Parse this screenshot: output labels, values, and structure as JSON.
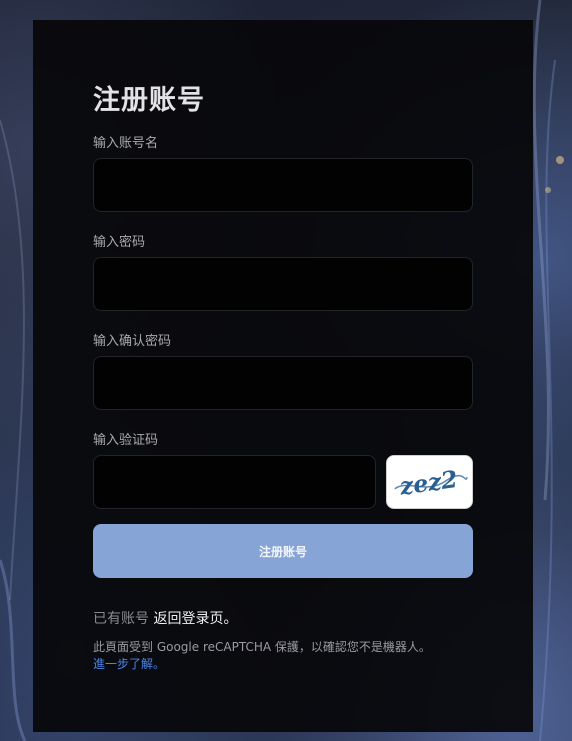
{
  "form": {
    "title": "注册账号",
    "username_label": "输入账号名",
    "username_value": "",
    "password_label": "输入密码",
    "password_value": "",
    "confirm_label": "输入确认密码",
    "confirm_value": "",
    "captcha_label": "输入验证码",
    "captcha_value": "",
    "captcha_image_text": "zez2",
    "submit_label": "注册账号"
  },
  "footer": {
    "have_account_text": "已有账号",
    "back_to_login_link": "返回登录页。",
    "recaptcha_notice": "此頁面受到 Google reCAPTCHA 保護，以確認您不是機器人。",
    "learn_more_link": "進一步了解。"
  },
  "colors": {
    "panel_bg": "#08080a",
    "submit_bg": "#86a5d6",
    "link_blue": "#4a86e8",
    "captcha_ink": "#2a5f92"
  },
  "icons": {
    "captcha": "captcha-image"
  }
}
